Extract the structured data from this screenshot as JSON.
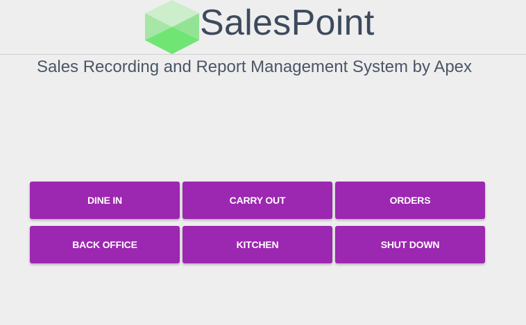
{
  "header": {
    "brand": "SalesPoint",
    "logo_icon": "green-cube-icon",
    "logo_colors": {
      "top": "#cdeecb",
      "left": "#9fe3a0",
      "right": "#86e38a",
      "bottom": "#6ce46f"
    }
  },
  "subtitle": "Sales Recording and Report Management System by Apex",
  "menu": {
    "buttons": [
      {
        "name": "dine-in-button",
        "label": "DINE IN"
      },
      {
        "name": "carry-out-button",
        "label": "CARRY OUT"
      },
      {
        "name": "orders-button",
        "label": "ORDERS"
      },
      {
        "name": "back-office-button",
        "label": "BACK OFFICE"
      },
      {
        "name": "kitchen-button",
        "label": "KITCHEN"
      },
      {
        "name": "shut-down-button",
        "label": "SHUT DOWN"
      }
    ],
    "accent": "#9c27b0"
  }
}
